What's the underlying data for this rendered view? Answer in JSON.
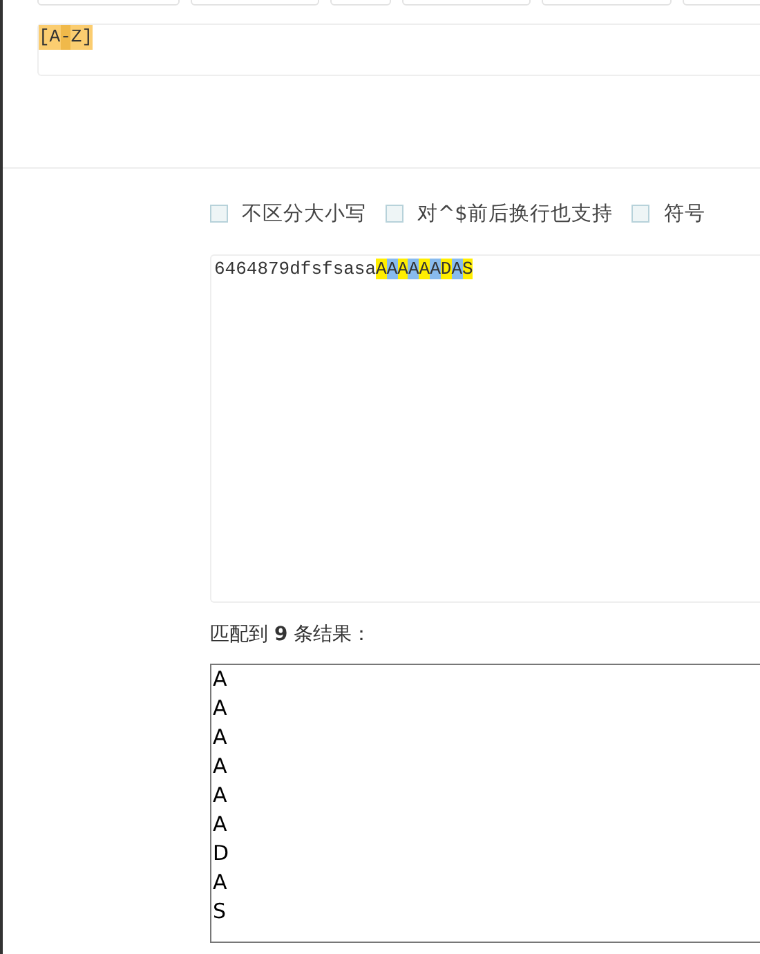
{
  "regex": {
    "tokens": [
      {
        "text": "[A",
        "kind": "class"
      },
      {
        "text": "-",
        "kind": "range"
      },
      {
        "text": "Z]",
        "kind": "class"
      }
    ]
  },
  "options": [
    {
      "label": "不区分大小写",
      "checked": false
    },
    {
      "label": "对^$前后换行也支持",
      "checked": false
    },
    {
      "label": "符号",
      "checked": false
    }
  ],
  "test_text": {
    "segments": [
      {
        "text": "6464879dfsfsasa",
        "kind": "plain"
      },
      {
        "text": "A",
        "kind": "match",
        "color": "#ffee00"
      },
      {
        "text": "A",
        "kind": "match",
        "color": "#88bbee"
      },
      {
        "text": "A",
        "kind": "match",
        "color": "#ffee00"
      },
      {
        "text": "A",
        "kind": "match",
        "color": "#88bbee"
      },
      {
        "text": "A",
        "kind": "match",
        "color": "#ffee00"
      },
      {
        "text": "A",
        "kind": "match",
        "color": "#88bbee"
      },
      {
        "text": "D",
        "kind": "match",
        "color": "#ffee00"
      },
      {
        "text": "A",
        "kind": "match",
        "color": "#88bbee"
      },
      {
        "text": "S",
        "kind": "match",
        "color": "#ffee00"
      }
    ]
  },
  "result_label": "匹配到 **9** 条结果：",
  "results": [
    "A",
    "A",
    "A",
    "A",
    "A",
    "A",
    "D",
    "A",
    "S"
  ]
}
